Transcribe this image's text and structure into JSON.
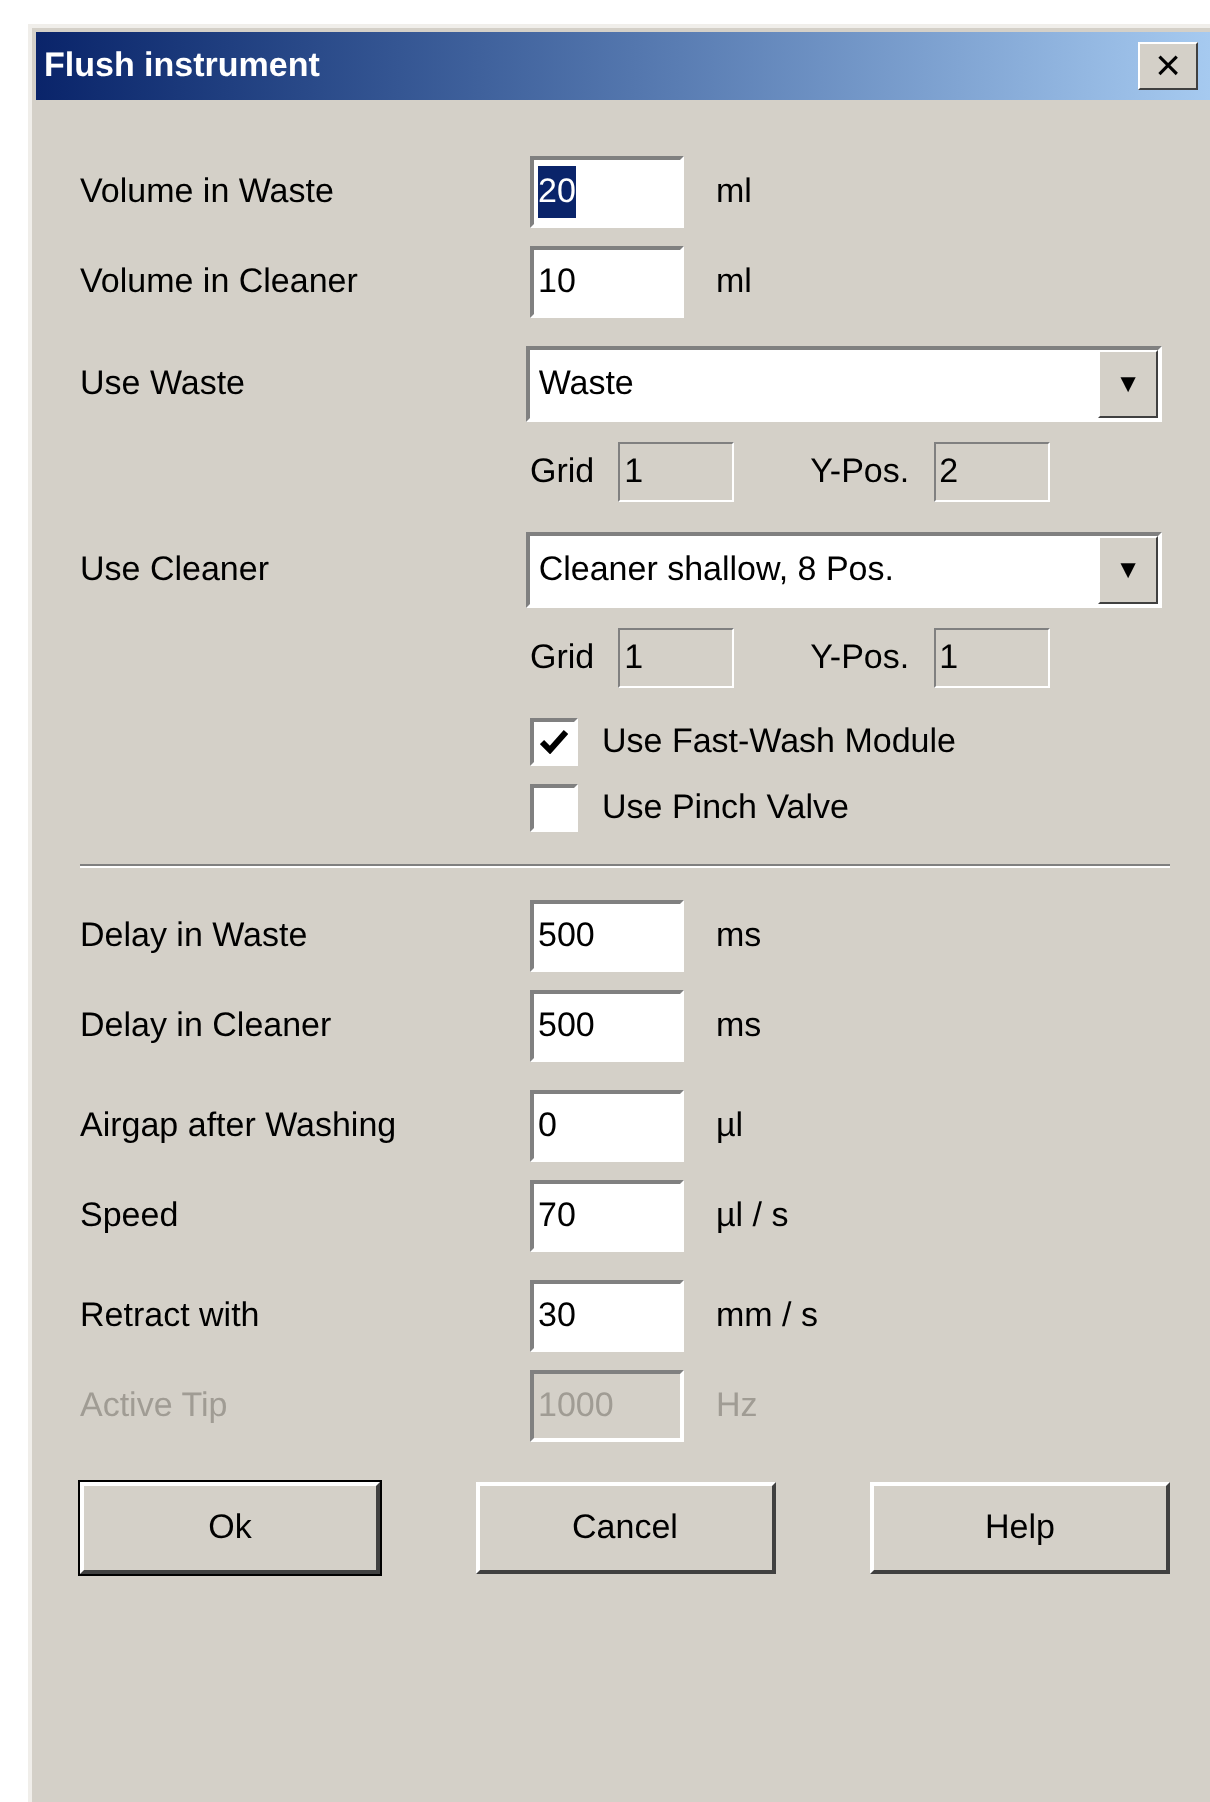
{
  "window": {
    "title": "Flush instrument",
    "close": "×"
  },
  "groups": [
    {
      "rows": [
        {
          "kind": "field",
          "label": "Volume in Waste",
          "value": "20",
          "unit": "ml",
          "disabled": false,
          "text_selected": true
        },
        {
          "kind": "field",
          "label": "Volume in Cleaner",
          "value": "10",
          "unit": "ml",
          "disabled": false,
          "text_selected": false
        }
      ]
    },
    {
      "rows": [
        {
          "kind": "dropdown",
          "label": "Use Waste",
          "value": "Waste",
          "arrow": "▼"
        },
        {
          "kind": "grid",
          "grid_label": "Grid",
          "grid": "1",
          "ypos_label": "Y-Pos.",
          "ypos": "2"
        }
      ]
    },
    {
      "rows": [
        {
          "kind": "dropdown",
          "label": "Use Cleaner",
          "value": "Cleaner shallow, 8 Pos.",
          "arrow": "▼"
        },
        {
          "kind": "grid",
          "grid_label": "Grid",
          "grid": "1",
          "ypos_label": "Y-Pos.",
          "ypos": "1"
        }
      ]
    },
    {
      "rows": [
        {
          "kind": "checkbox",
          "label": "Use Fast-Wash Module",
          "checked": true
        },
        {
          "kind": "checkbox",
          "label": "Use Pinch Valve",
          "checked": false
        }
      ]
    },
    {
      "rows": [
        {
          "kind": "separator"
        }
      ]
    },
    {
      "rows": [
        {
          "kind": "field",
          "label": "Delay in Waste",
          "value": "500",
          "unit": "ms",
          "disabled": false,
          "text_selected": false
        },
        {
          "kind": "field",
          "label": "Delay in Cleaner",
          "value": "500",
          "unit": "ms",
          "disabled": false,
          "text_selected": false
        }
      ]
    },
    {
      "rows": [
        {
          "kind": "field",
          "label": "Airgap after Washing",
          "value": "0",
          "unit": "µl",
          "disabled": false,
          "text_selected": false
        },
        {
          "kind": "field",
          "label": "Speed",
          "value": "70",
          "unit": "µl / s",
          "disabled": false,
          "text_selected": false
        }
      ]
    },
    {
      "rows": [
        {
          "kind": "field",
          "label": "Retract with",
          "value": "30",
          "unit": "mm / s",
          "disabled": false,
          "text_selected": false
        },
        {
          "kind": "field",
          "label": "Active Tip",
          "value": "1000",
          "unit": "Hz",
          "disabled": true,
          "text_selected": false
        }
      ]
    }
  ],
  "buttons": [
    {
      "label": "Ok",
      "default": true
    },
    {
      "label": "Cancel",
      "default": false
    },
    {
      "label": "Help",
      "default": false
    }
  ]
}
